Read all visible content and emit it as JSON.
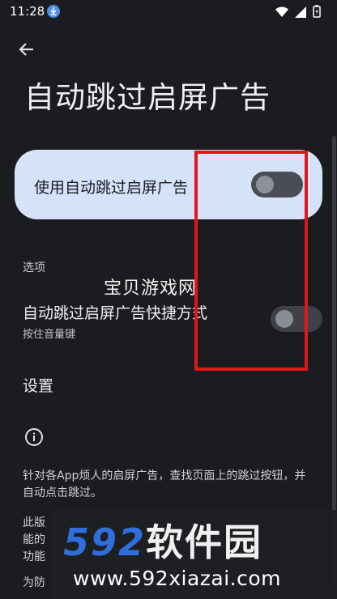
{
  "status": {
    "time": "11:28"
  },
  "header": {
    "title": "自动跳过启屏广告"
  },
  "main_toggle": {
    "label": "使用自动跳过启屏广告",
    "on": false
  },
  "options": {
    "section_title": "选项",
    "shortcut_title": "自动跳过启屏广告快捷方式",
    "shortcut_subtitle": "按住音量键",
    "shortcut_on": false
  },
  "settings": {
    "title": "设置"
  },
  "description": {
    "line1": "针对各App烦人的启屏广告，查找页面上的跳过按钮，并自动点击跳过。",
    "line2": "此版能的功能",
    "line3": "为防"
  },
  "watermark": {
    "text": "宝贝游戏网"
  },
  "logo": {
    "number": "592",
    "brand": "软件园",
    "url": "www.592xiazai.com"
  },
  "colors": {
    "card": "#d6e2f8",
    "highlight": "#e0161b",
    "brand_blue": "#2f6fdd"
  }
}
